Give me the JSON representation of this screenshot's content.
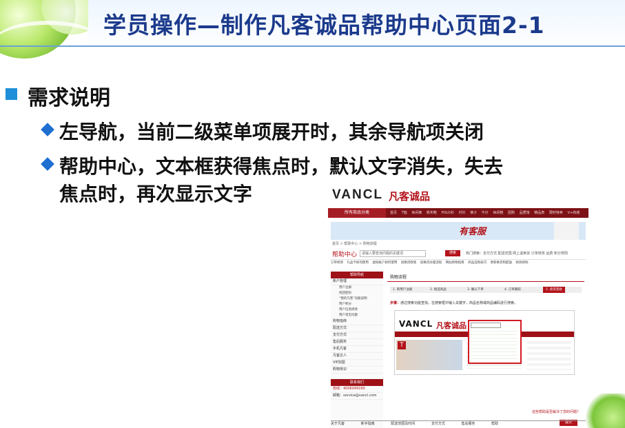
{
  "slide": {
    "title": "学员操作—制作凡客诚品帮助中心页面2-1",
    "heading": "需求说明",
    "bullets": [
      "左导航，当前二级菜单项展开时，其余导航项关闭",
      "帮助中心，文本框获得焦点时，默认文字消失，失去",
      "焦点时，再次显示文字"
    ]
  },
  "screenshot": {
    "logo": "VANCL",
    "logo_cn": "凡客诚品",
    "all_categories": "所有商品分类",
    "top_nav": [
      "首页",
      "T恤",
      "休闲裤",
      "帆布鞋",
      "POLO衫",
      "衬衫",
      "裤子",
      "牛仔",
      "休闲鞋",
      "团购",
      "品质馆",
      "精品表",
      "限时特卖",
      "V+商城"
    ],
    "banner_text": "有客服",
    "breadcrumb": "首页 > 帮助中心 > 购物流程",
    "help_title": "帮助中心",
    "search_placeholder": "请输入要查询问题的关键词",
    "search_button": "搜索",
    "hot": "热门搜索：支付方式   配送范围   网上退换货   订单修改   运费   积分规则",
    "quick_links": [
      "订单修改",
      "礼品卡如何使用",
      "虚拟账户如何使用",
      "退换货政策",
      "退换货办理流程",
      "网站购物指南",
      "商品选购技巧",
      "更新换货和配送",
      "防伪辨别"
    ],
    "sidebar_title": "帮助导航",
    "sidebar": [
      {
        "label": "账户管理",
        "subs": [
          "用户注册",
          "找回密码",
          "“我的凡客”功能说明",
          "用户积分",
          "用户信息修改",
          "用户常见问题"
        ]
      },
      {
        "label": "购物指南",
        "subs": []
      },
      {
        "label": "配送方式",
        "subs": []
      },
      {
        "label": "支付方式",
        "subs": []
      },
      {
        "label": "售后服务",
        "subs": []
      },
      {
        "label": "手机凡客",
        "subs": []
      },
      {
        "label": "凡客达人",
        "subs": []
      },
      {
        "label": "VIP加盟",
        "subs": []
      },
      {
        "label": "购物常识",
        "subs": []
      }
    ],
    "sidebar_contact_title": "联系我们",
    "hotline": "热线：4006045090",
    "email": "邮箱：service@vancl.com",
    "content_title": "购物流程",
    "steps": [
      "1. 新用户注册",
      "2. 挑选商品",
      "3. 确认下单",
      "4. 订单跟踪",
      "5. 验货签收"
    ],
    "tip_bold": "步骤：",
    "tip_text": "通过搜索功能查找。在搜索框中输入关键字，商品名称或商品编码进行搜索。",
    "inner_logo": "VANCL",
    "inner_logo_cn": "凡客诚品",
    "inner_badge": "T",
    "ask": "这些帮助是否解决了您的问题？",
    "submit": "提交",
    "footer": [
      "关于凡客",
      "新手指南",
      "配送范围及时间",
      "支付方式",
      "售后服务",
      "帮助"
    ]
  }
}
